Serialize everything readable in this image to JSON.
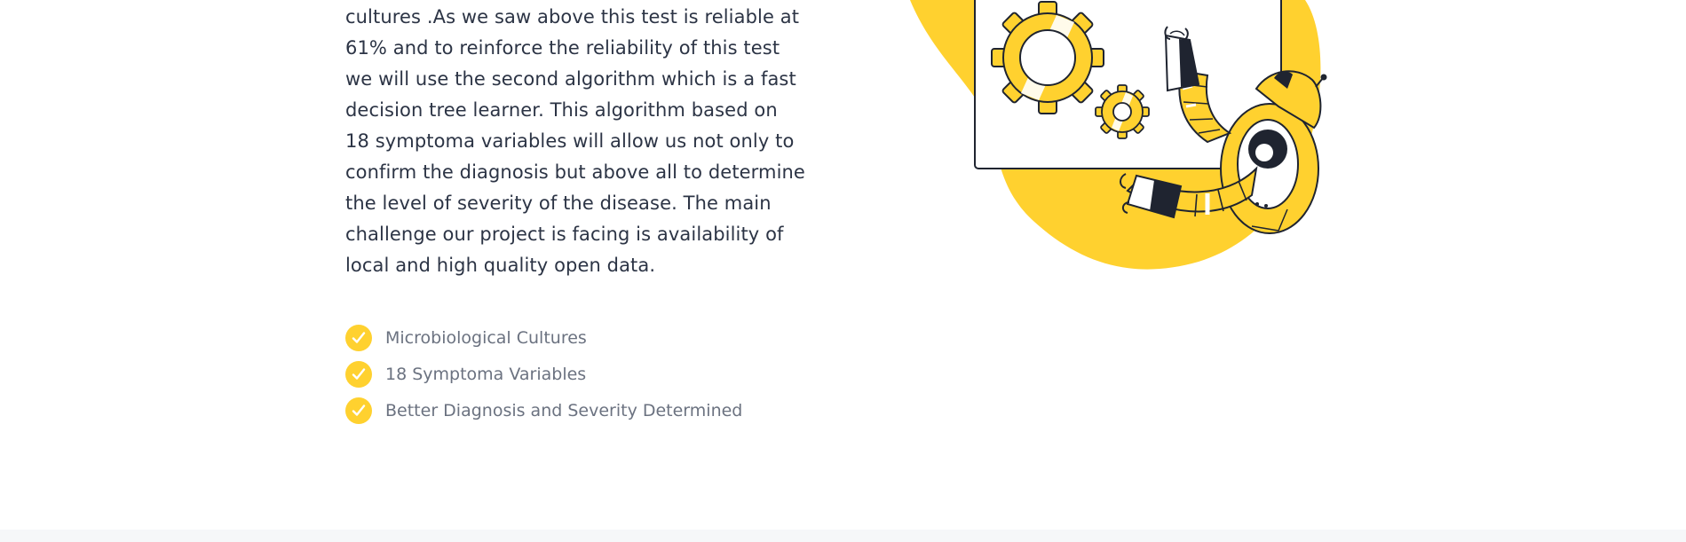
{
  "colors": {
    "accent": "#ffd12f",
    "text_dark": "#2c3445",
    "text_muted": "#6b7280",
    "footer_band": "#f6f7f9"
  },
  "content": {
    "paragraph": "cultures .As we saw above this test is reliable at 61% and to reinforce the reliability of this test we will use the second algorithm which is a fast decision tree learner. This algorithm based on 18 symptoma variables will allow us not only to confirm the diagnosis but above all to determine the level of severity of the disease. The main challenge our project is facing is availability of local and high quality open data."
  },
  "features": [
    {
      "label": "Microbiological Cultures",
      "icon": "check-circle-icon"
    },
    {
      "label": "18 Symptoma Variables",
      "icon": "check-circle-icon"
    },
    {
      "label": "Better Diagnosis and Severity Determined",
      "icon": "check-circle-icon"
    }
  ],
  "illustration": {
    "icon": "robot-arms-gears-illustration"
  }
}
